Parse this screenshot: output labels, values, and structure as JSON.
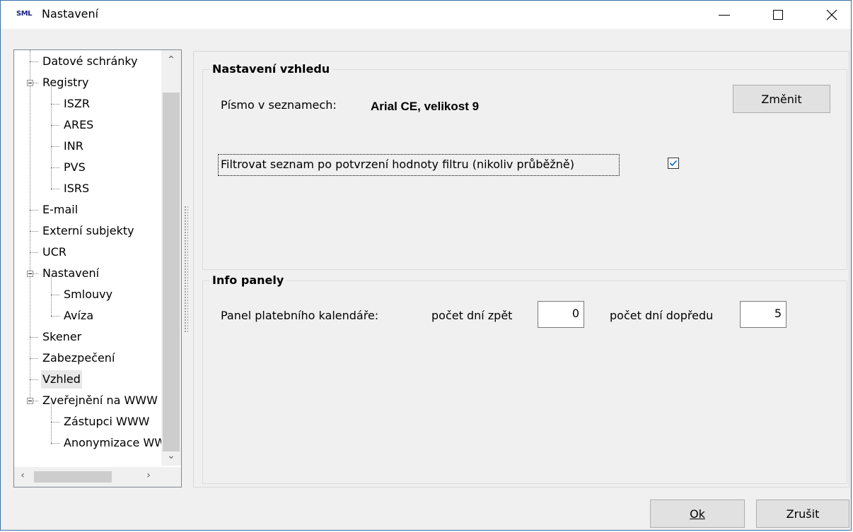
{
  "window": {
    "app_logo": "SML",
    "title": "Nastavení"
  },
  "tree": {
    "items": [
      {
        "label": "Datové schránky",
        "level": 1
      },
      {
        "label": "Registry",
        "level": 1,
        "expanded": true
      },
      {
        "label": "ISZR",
        "level": 2
      },
      {
        "label": "ARES",
        "level": 2
      },
      {
        "label": "INR",
        "level": 2
      },
      {
        "label": "PVS",
        "level": 2
      },
      {
        "label": "ISRS",
        "level": 2
      },
      {
        "label": "E-mail",
        "level": 1
      },
      {
        "label": "Externí subjekty",
        "level": 1
      },
      {
        "label": "UCR",
        "level": 1
      },
      {
        "label": "Nastavení",
        "level": 1,
        "expanded": true
      },
      {
        "label": "Smlouvy",
        "level": 2
      },
      {
        "label": "Avíza",
        "level": 2
      },
      {
        "label": "Skener",
        "level": 1
      },
      {
        "label": "Zabezpečení",
        "level": 1
      },
      {
        "label": "Vzhled",
        "level": 1,
        "selected": true
      },
      {
        "label": "Zveřejnění na WWW",
        "level": 1,
        "expanded": true
      },
      {
        "label": "Zástupci WWW",
        "level": 2
      },
      {
        "label": "Anonymizace WWW",
        "level": 2
      }
    ]
  },
  "appearance": {
    "group_title": "Nastavení vzhledu",
    "font_label": "Písmo v seznamech:",
    "font_value": "Arial CE, velikost 9",
    "change_button": "Změnit",
    "filter_label": "Filtrovat seznam po potvrzení hodnoty filtru (nikoliv průběžně)",
    "filter_checked": true
  },
  "info_panels": {
    "group_title": "Info panely",
    "calendar_label": "Panel platebního kalendáře:",
    "days_back_label": "počet dní zpět",
    "days_back_value": "0",
    "days_forward_label": "počet dní dopředu",
    "days_forward_value": "5"
  },
  "footer": {
    "ok_label": "Ok",
    "cancel_label": "Zrušit"
  },
  "colors": {
    "window_border": "#3a6ea5",
    "checkbox_check": "#0066cc"
  }
}
